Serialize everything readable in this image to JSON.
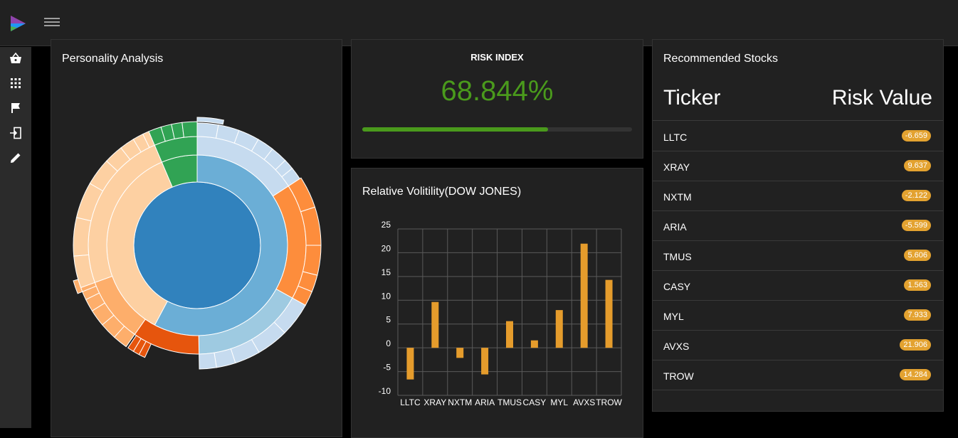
{
  "app": {
    "logo_icon": "play-logo-icon",
    "menu_icon": "hamburger-menu-icon"
  },
  "sidebar": {
    "items": [
      {
        "icon": "shopping-basket-icon"
      },
      {
        "icon": "apps-grid-icon"
      },
      {
        "icon": "flag-icon"
      },
      {
        "icon": "login-icon"
      },
      {
        "icon": "pencil-icon"
      }
    ]
  },
  "personality": {
    "title": "Personality Analysis"
  },
  "risk": {
    "title": "RISK INDEX",
    "value_text": "68.844%",
    "value": 68.844,
    "color": "#4a9a1c"
  },
  "volatility": {
    "title": "Relative Volitility(DOW JONES)"
  },
  "recommended": {
    "title": "Recommended Stocks",
    "col_ticker": "Ticker",
    "col_risk": "Risk Value",
    "rows": [
      {
        "ticker": "LLTC",
        "value": "-6.659"
      },
      {
        "ticker": "XRAY",
        "value": "9.637"
      },
      {
        "ticker": "NXTM",
        "value": "-2.122"
      },
      {
        "ticker": "ARIA",
        "value": "-5.599"
      },
      {
        "ticker": "TMUS",
        "value": "5.606"
      },
      {
        "ticker": "CASY",
        "value": "1.563"
      },
      {
        "ticker": "MYL",
        "value": "7.933"
      },
      {
        "ticker": "AVXS",
        "value": "21.906"
      },
      {
        "ticker": "TROW",
        "value": "14.284"
      }
    ]
  },
  "chart_data": [
    {
      "type": "bar",
      "title": "Relative Volitility(DOW JONES)",
      "categories": [
        "LLTC",
        "XRAY",
        "NXTM",
        "ARIA",
        "TMUS",
        "CASY",
        "MYL",
        "AVXS",
        "TROW"
      ],
      "values": [
        -6.659,
        9.637,
        -2.122,
        -5.599,
        5.606,
        1.563,
        7.933,
        21.906,
        14.284
      ],
      "ylim": [
        -10,
        25
      ],
      "yticks": [
        "25",
        "20",
        "15",
        "10",
        "5",
        "0",
        "-5",
        "-10"
      ],
      "grid": true,
      "color": "#e59c2c"
    },
    {
      "type": "pie",
      "title": "Personality Analysis",
      "rings": [
        {
          "ring": "center",
          "color": "#3182bd",
          "value": 1
        },
        {
          "ring": "inner",
          "groups": [
            {
              "color": "#6baed6",
              "share": 0.55
            },
            {
              "color": "#fdae6b",
              "share": 0.35
            },
            {
              "color": "#31a354",
              "share": 0.1
            }
          ]
        }
      ]
    }
  ]
}
